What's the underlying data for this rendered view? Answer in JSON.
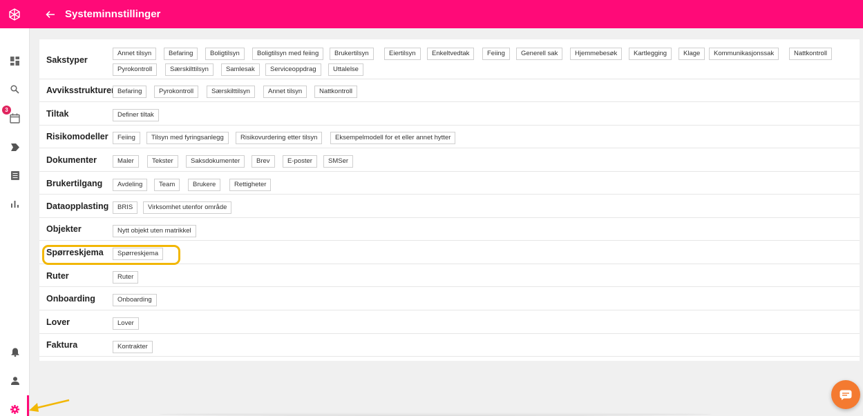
{
  "header": {
    "title": "Systeminnstillinger",
    "back_icon": "arrow-left-icon",
    "logo_icon": "snowflake-logo-icon",
    "color": "#ff0a78"
  },
  "sidebar": {
    "items": [
      {
        "icon": "dashboard-icon"
      },
      {
        "icon": "search-icon"
      },
      {
        "icon": "calendar-icon",
        "badge": "3"
      },
      {
        "icon": "tag-icon"
      },
      {
        "icon": "document-icon"
      },
      {
        "icon": "bar-chart-icon"
      },
      {
        "icon": "bell-icon"
      },
      {
        "icon": "user-icon"
      },
      {
        "icon": "gear-icon",
        "active": true
      }
    ]
  },
  "sections": [
    {
      "label": "Sakstyper",
      "items": [
        "Annet tilsyn",
        "Befaring",
        "Boligtilsyn",
        "Boligtilsyn med feiing",
        "Brukertilsyn",
        "Eiertilsyn",
        "Enkeltvedtak",
        "Feiing",
        "Generell sak",
        "Hjemmebesøk",
        "Kartlegging",
        "Klage",
        "Kommunikasjonssak",
        "Nattkontroll",
        "Pyrokontroll",
        "Særskilttilsyn",
        "Samlesak",
        "Serviceoppdrag",
        "Uttalelse"
      ]
    },
    {
      "label": "Avviksstrukturer",
      "items": [
        "Befaring",
        "Pyrokontroll",
        "Særskilttilsyn",
        "Annet tilsyn",
        "Nattkontroll"
      ]
    },
    {
      "label": "Tiltak",
      "items": [
        "Definer tiltak"
      ]
    },
    {
      "label": "Risikomodeller",
      "items": [
        "Feiing",
        "Tilsyn med fyringsanlegg",
        "Risikovurdering etter tilsyn",
        "Eksempelmodell for et eller annet hytter"
      ]
    },
    {
      "label": "Dokumenter",
      "items": [
        "Maler",
        "Tekster",
        "Saksdokumenter",
        "Brev",
        "E-poster",
        "SMSer"
      ]
    },
    {
      "label": "Brukertilgang",
      "items": [
        "Avdeling",
        "Team",
        "Brukere",
        "Rettigheter"
      ]
    },
    {
      "label": "Dataopplasting",
      "items": [
        "BRIS",
        "Virksomhet utenfor område"
      ]
    },
    {
      "label": "Objekter",
      "items": [
        "Nytt objekt uten matrikkel"
      ]
    },
    {
      "label": "Spørreskjema",
      "items": [
        "Spørreskjema"
      ]
    },
    {
      "label": "Ruter",
      "items": [
        "Ruter"
      ]
    },
    {
      "label": "Onboarding",
      "items": [
        "Onboarding"
      ]
    },
    {
      "label": "Lover",
      "items": [
        "Lover"
      ]
    },
    {
      "label": "Faktura",
      "items": [
        "Kontrakter"
      ]
    }
  ],
  "chat": {
    "icon": "chat-icon",
    "color": "#f47a30"
  },
  "annotation": {
    "highlight_color": "#f2b705"
  }
}
